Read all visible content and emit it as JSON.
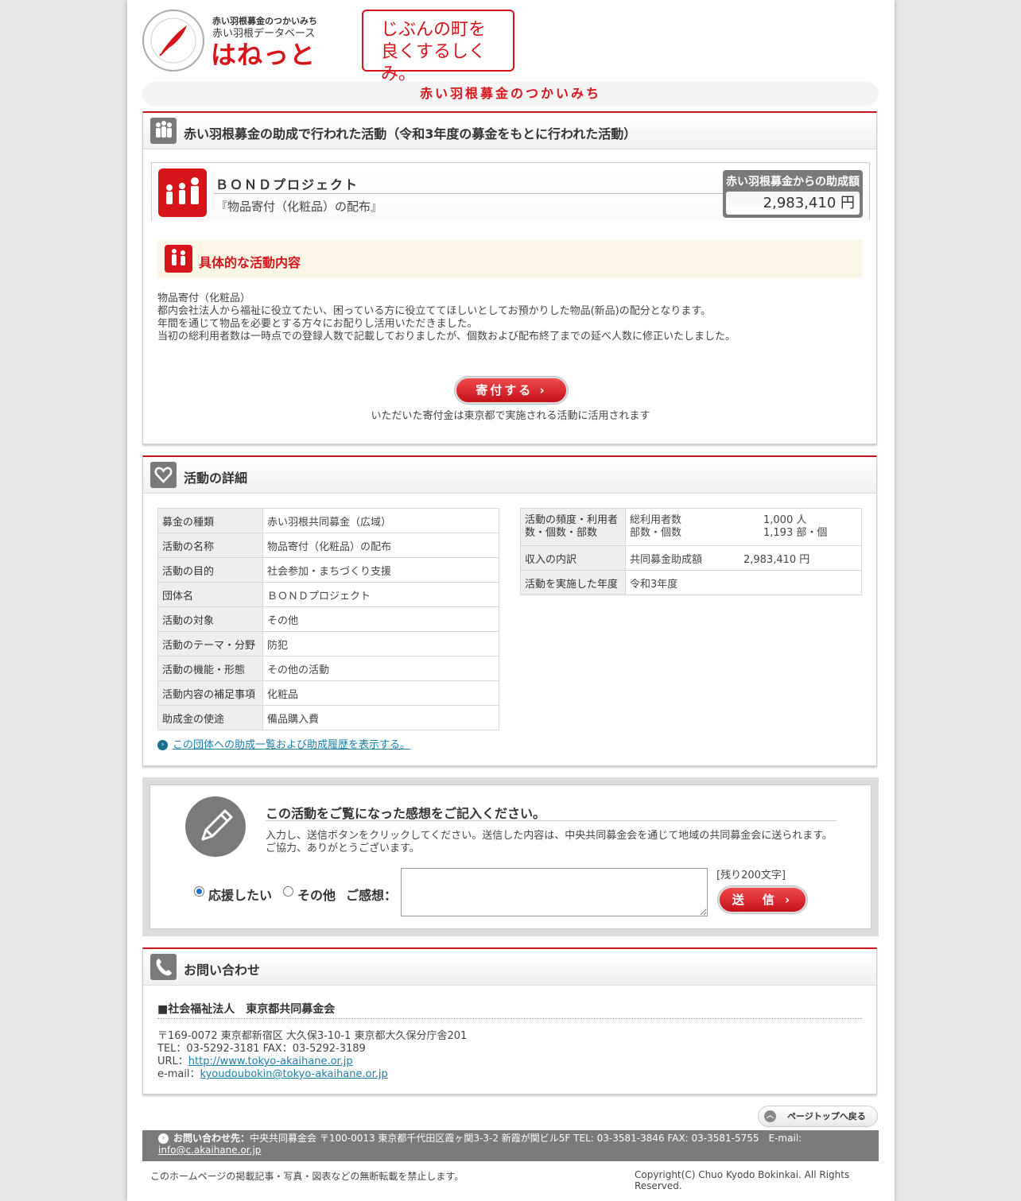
{
  "header": {
    "logo_sub1": "赤い羽根募金のつかいみち",
    "logo_sub2": "赤い羽根データベース",
    "logo_main": "はねっと",
    "slogan_line1": "じぶんの町を",
    "slogan_line2": "良くするしくみ。"
  },
  "banner": "赤い羽根募金のつかいみち",
  "activity_section": {
    "title": "赤い羽根募金の助成で行われた活動（令和3年度の募金をもとに行われた活動）",
    "project_name": "ＢＯＮＤプロジェクト",
    "project_sub": "『物品寄付（化粧品）の配布』",
    "grant_label": "赤い羽根募金からの助成額",
    "grant_amount": "2,983,410 円",
    "content_title": "具体的な活動内容",
    "content_lines": [
      "物品寄付（化粧品）",
      "都内会社法人から福祉に役立てたい、困っている方に役立ててほしいとしてお預かりした物品(新品)の配分となります。",
      "年間を通じて物品を必要とする方々にお配りし活用いただきました。",
      "当初の総利用者数は一時点での登録人数で記載しておりましたが、個数および配布終了までの延べ人数に修正いたしました。"
    ],
    "donate_button": "寄付する",
    "donate_note": "いただいた寄付金は東京都で実施される活動に活用されます"
  },
  "details_section": {
    "title": "活動の詳細",
    "left_table": [
      {
        "key": "募金の種類",
        "value": "赤い羽根共同募金（広域）"
      },
      {
        "key": "活動の名称",
        "value": "物品寄付（化粧品）の配布"
      },
      {
        "key": "活動の目的",
        "value": "社会参加・まちづくり支援"
      },
      {
        "key": "団体名",
        "value": "ＢＯＮＤプロジェクト"
      },
      {
        "key": "活動の対象",
        "value": "その他"
      },
      {
        "key": "活動のテーマ・分野",
        "value": "防犯"
      },
      {
        "key": "活動の機能・形態",
        "value": "その他の活動"
      },
      {
        "key": "活動内容の補足事項",
        "value": "化粧品"
      },
      {
        "key": "助成金の使途",
        "value": "備品購入費"
      }
    ],
    "right_table": {
      "freq_key_line1": "活動の頻度・利用者",
      "freq_key_line2": "数・個数・部数",
      "users_label": "総利用者数",
      "users_value": "1,000 人",
      "items_label": "部数・個数",
      "items_value": "1,193 部・個",
      "income_key": "収入の内訳",
      "income_label": "共同募金助成額",
      "income_value": "2,983,410 円",
      "year_key": "活動を実施した年度",
      "year_value": "令和3年度"
    },
    "history_link": "この団体への助成一覧および助成履歴を表示する。"
  },
  "feedback": {
    "title": "この活動をご覧になった感想をご記入ください。",
    "desc1": "入力し、送信ボタンをクリックしてください。送信した内容は、中央共同募金会を通じて地域の共同募金会に送られます。",
    "desc2": "ご協力、ありがとうございます。",
    "radio_support": "応援したい",
    "radio_other": "その他",
    "comment_label": "ご感想：",
    "remaining": "[残り200文字]",
    "send_button": "送　信"
  },
  "contact_section": {
    "title": "お問い合わせ",
    "org": "■社会福祉法人　東京都共同募金会",
    "address": "〒169-0072 東京都新宿区 大久保3-10-1 東京都大久保分庁舎201",
    "tel_fax": "TEL：03-5292-3181 FAX：03-5292-3189",
    "url_label": "URL：",
    "url": "http://www.tokyo-akaihane.or.jp",
    "email_label": "e-mail：",
    "email": "kyoudoubokin@tokyo-akaihane.or.jp"
  },
  "page_top": "ページトップへ戻る",
  "footer": {
    "contact_label": "お問い合わせ先：",
    "contact_text": "中央共同募金会 〒100-0013 東京都千代田区霞ヶ関3-3-2 新霞が関ビル5F TEL: 03-3581-3846 FAX: 03-3581-5755　E-mail:",
    "email": "info@c.akaihane.or.jp",
    "notice": "このホームページの掲載記事・写真・図表などの無断転載を禁止します。",
    "copyright": "Copyright(C) Chuo Kyodo Bokinkai. All Rights Reserved."
  },
  "colors": {
    "brand_red": "#d7141a",
    "gray": "#7a7a7a",
    "link": "#1a7fa8"
  }
}
